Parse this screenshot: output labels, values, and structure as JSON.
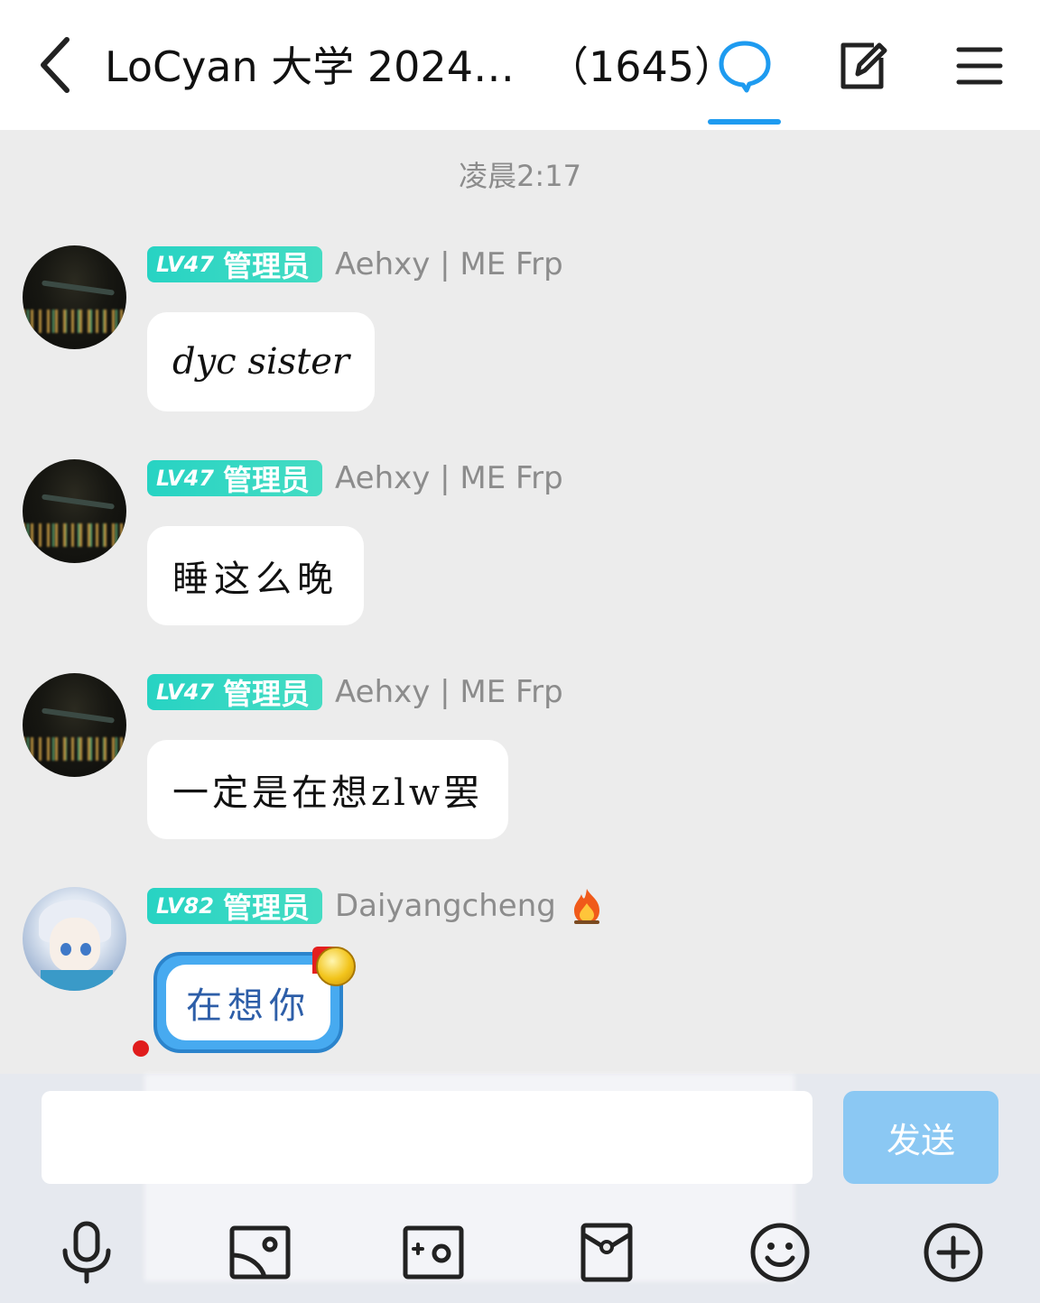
{
  "header": {
    "title": "LoCyan 大学 2024…",
    "member_count": "（1645）",
    "accent": "#1e9bf0"
  },
  "chat": {
    "timestamp": "凌晨2:17",
    "messages": [
      {
        "level": "LV47",
        "role": "管理员",
        "name": "Aehxy | ME Frp",
        "text": "dyc sister"
      },
      {
        "level": "LV47",
        "role": "管理员",
        "name": "Aehxy | ME Frp",
        "text": "睡这么晚"
      },
      {
        "level": "LV47",
        "role": "管理员",
        "name": "Aehxy | ME Frp",
        "text": "一定是在想zlw罢"
      },
      {
        "level": "LV82",
        "role": "管理员",
        "name": "Daiyangcheng",
        "text": "在想你"
      }
    ]
  },
  "composer": {
    "input_value": "",
    "send_label": "发送"
  },
  "icons": {
    "back": "chevron-left-icon",
    "chat_tab": "chat-bubble-icon",
    "edit": "edit-icon",
    "menu": "menu-icon",
    "fire": "fire-emoji-icon",
    "toolbar": [
      "microphone-icon",
      "image-icon",
      "camera-icon",
      "red-packet-icon",
      "emoji-icon",
      "plus-icon"
    ]
  }
}
